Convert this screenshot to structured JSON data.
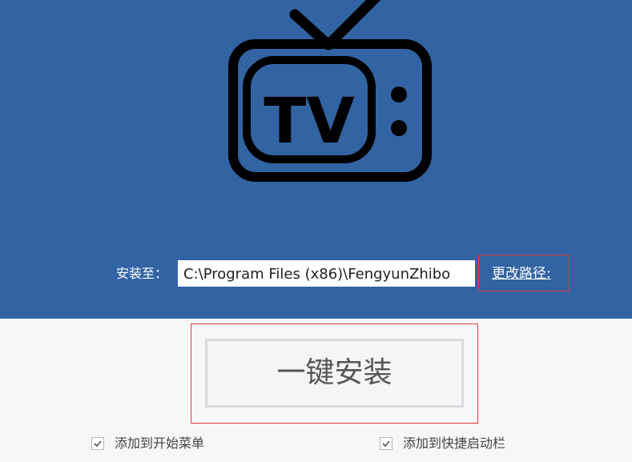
{
  "colors": {
    "hero_background": "#3264a4",
    "page_background": "#f7f7f7",
    "highlight_border": "#e0393e",
    "tv_icon": "#000000"
  },
  "logo": {
    "icon": "tv-icon",
    "text": "TV"
  },
  "install_path": {
    "label": "安装至：",
    "value": "C:\\Program Files (x86)\\FengyunZhibo",
    "change_link": "更改路径:"
  },
  "install_button": {
    "label": "一键安装"
  },
  "options": [
    {
      "label": "添加到开始菜单",
      "checked": true
    },
    {
      "label": "添加到快捷启动栏",
      "checked": true
    }
  ]
}
